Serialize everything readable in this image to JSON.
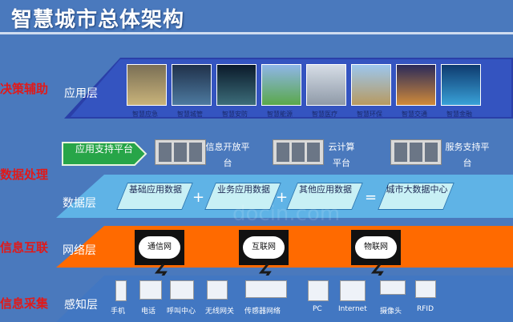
{
  "title": "智慧城市总体架构",
  "side_labels": [
    "决策辅助",
    "数据处理",
    "信息互联",
    "信息采集"
  ],
  "layers": {
    "application": "应用层",
    "data": "数据层",
    "network": "网络层",
    "perception": "感知层"
  },
  "apps": [
    "智慧应急",
    "智慧城管",
    "智慧安防",
    "智慧能源",
    "智慧医疗",
    "智慧环保",
    "智慧交通",
    "智慧金融"
  ],
  "support": {
    "arrow": "应用支持平台",
    "platforms": [
      "信息开放平台",
      "云计算平台",
      "服务支持平台"
    ]
  },
  "data_boxes": [
    "基础应用数据",
    "业务应用数据",
    "其他应用数据",
    "城市大数据中心"
  ],
  "operators": [
    "+",
    "+",
    "="
  ],
  "networks": [
    "通信网",
    "互联网",
    "物联网"
  ],
  "devices": [
    "手机",
    "电话",
    "呼叫中心",
    "无线网关",
    "传感器网络",
    "PC",
    "Internet",
    "摄像头",
    "RFID"
  ],
  "watermark": "docin.com",
  "colors": {
    "bg": "#4a79bd",
    "side": "#e01a1a",
    "app_band": "#2a3fa8",
    "data_band": "#5fb3e6",
    "net_band": "#ff6a00",
    "sense_band": "#4277c2"
  }
}
